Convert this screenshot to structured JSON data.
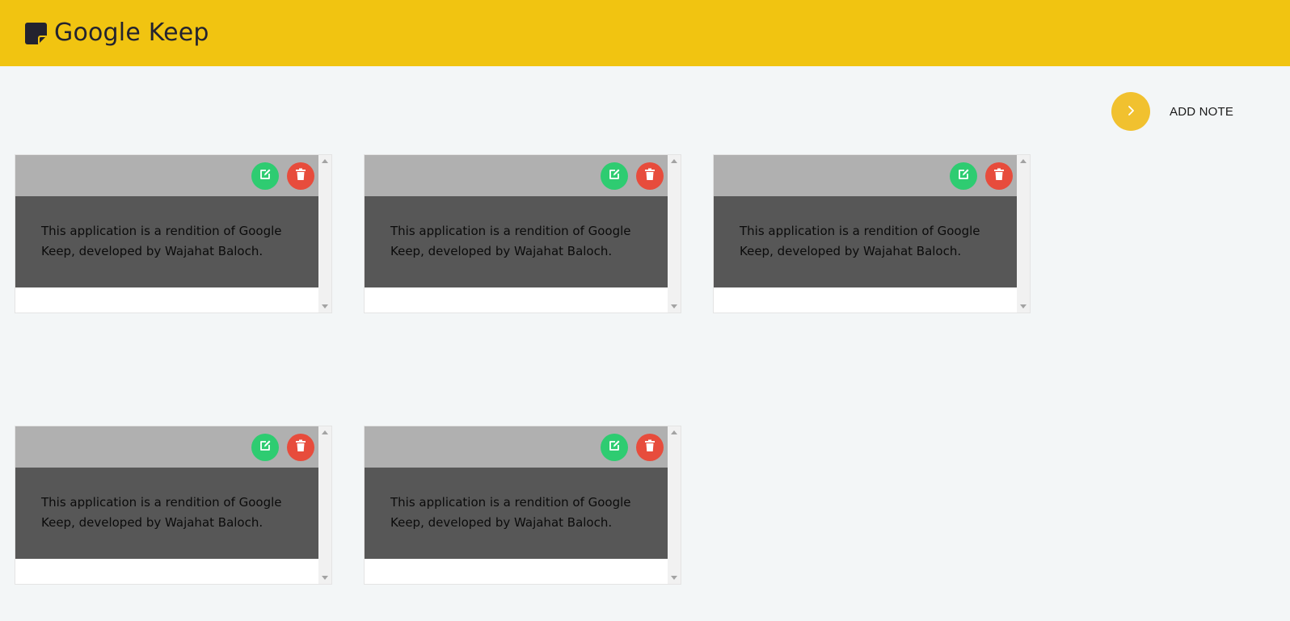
{
  "header": {
    "title": "Google Keep",
    "logo_icon": "sticky-note-icon",
    "background": "#f1c411"
  },
  "add_note": {
    "label": "ADD NOTE",
    "icon": "chevron-right-icon",
    "color": "#f1c12f"
  },
  "notes": [
    {
      "text": "This application is a rendition of Google Keep, developed by Wajahat Baloch."
    },
    {
      "text": "This application is a rendition of Google Keep, developed by Wajahat Baloch."
    },
    {
      "text": "This application is a rendition of Google Keep, developed by Wajahat Baloch."
    },
    {
      "text": "This application is a rendition of Google Keep, developed by Wajahat Baloch."
    },
    {
      "text": "This application is a rendition of Google Keep, developed by Wajahat Baloch."
    }
  ],
  "note_actions": {
    "edit_icon": "edit-icon",
    "delete_icon": "trash-icon",
    "edit_color": "#2ecc71",
    "delete_color": "#e74c3c"
  }
}
